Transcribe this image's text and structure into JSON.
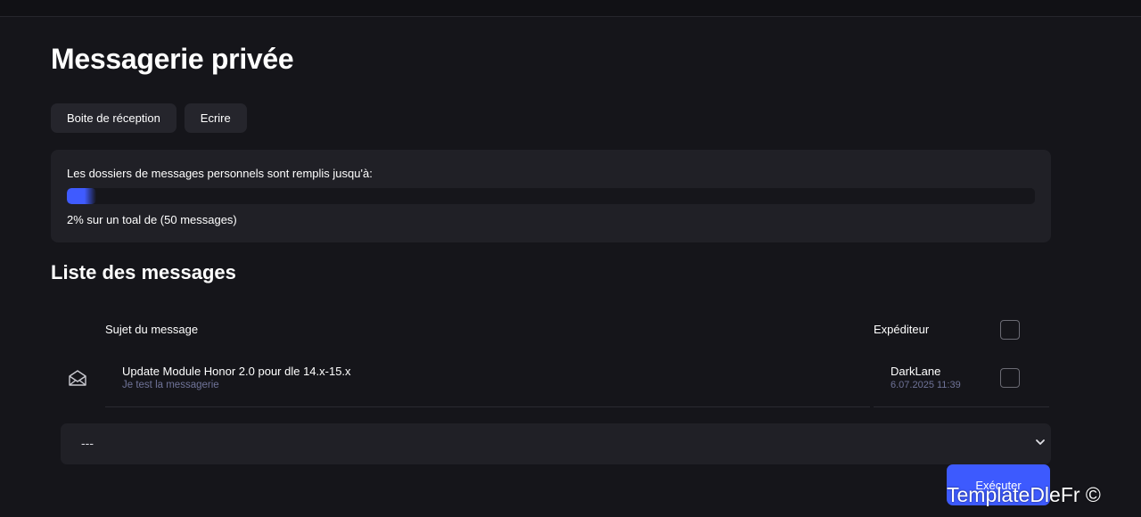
{
  "page": {
    "title": "Messagerie privée"
  },
  "tabs": [
    {
      "label": "Boite de réception"
    },
    {
      "label": "Ecrire"
    }
  ],
  "quota": {
    "label": "Les dossiers de messages personnels sont remplis jusqu'à:",
    "percent": 2,
    "info": "2% sur un toal de (50 messages)",
    "fill_color": "#3f5bff"
  },
  "list": {
    "title": "Liste des messages",
    "col_subject": "Sujet du message",
    "col_sender": "Expéditeur",
    "rows": [
      {
        "icon": "envelope-open-icon",
        "subject": "Update Module Honor 2.0 pour dle 14.x-15.x",
        "preview": "Je test la messagerie",
        "sender": "DarkLane",
        "date": "6.07.2025 11:39"
      }
    ]
  },
  "action_select": {
    "value": "---"
  },
  "execute_button": {
    "label": "Exécuter",
    "color": "#3d5afe"
  },
  "watermark": "TemplateDleFr ©"
}
